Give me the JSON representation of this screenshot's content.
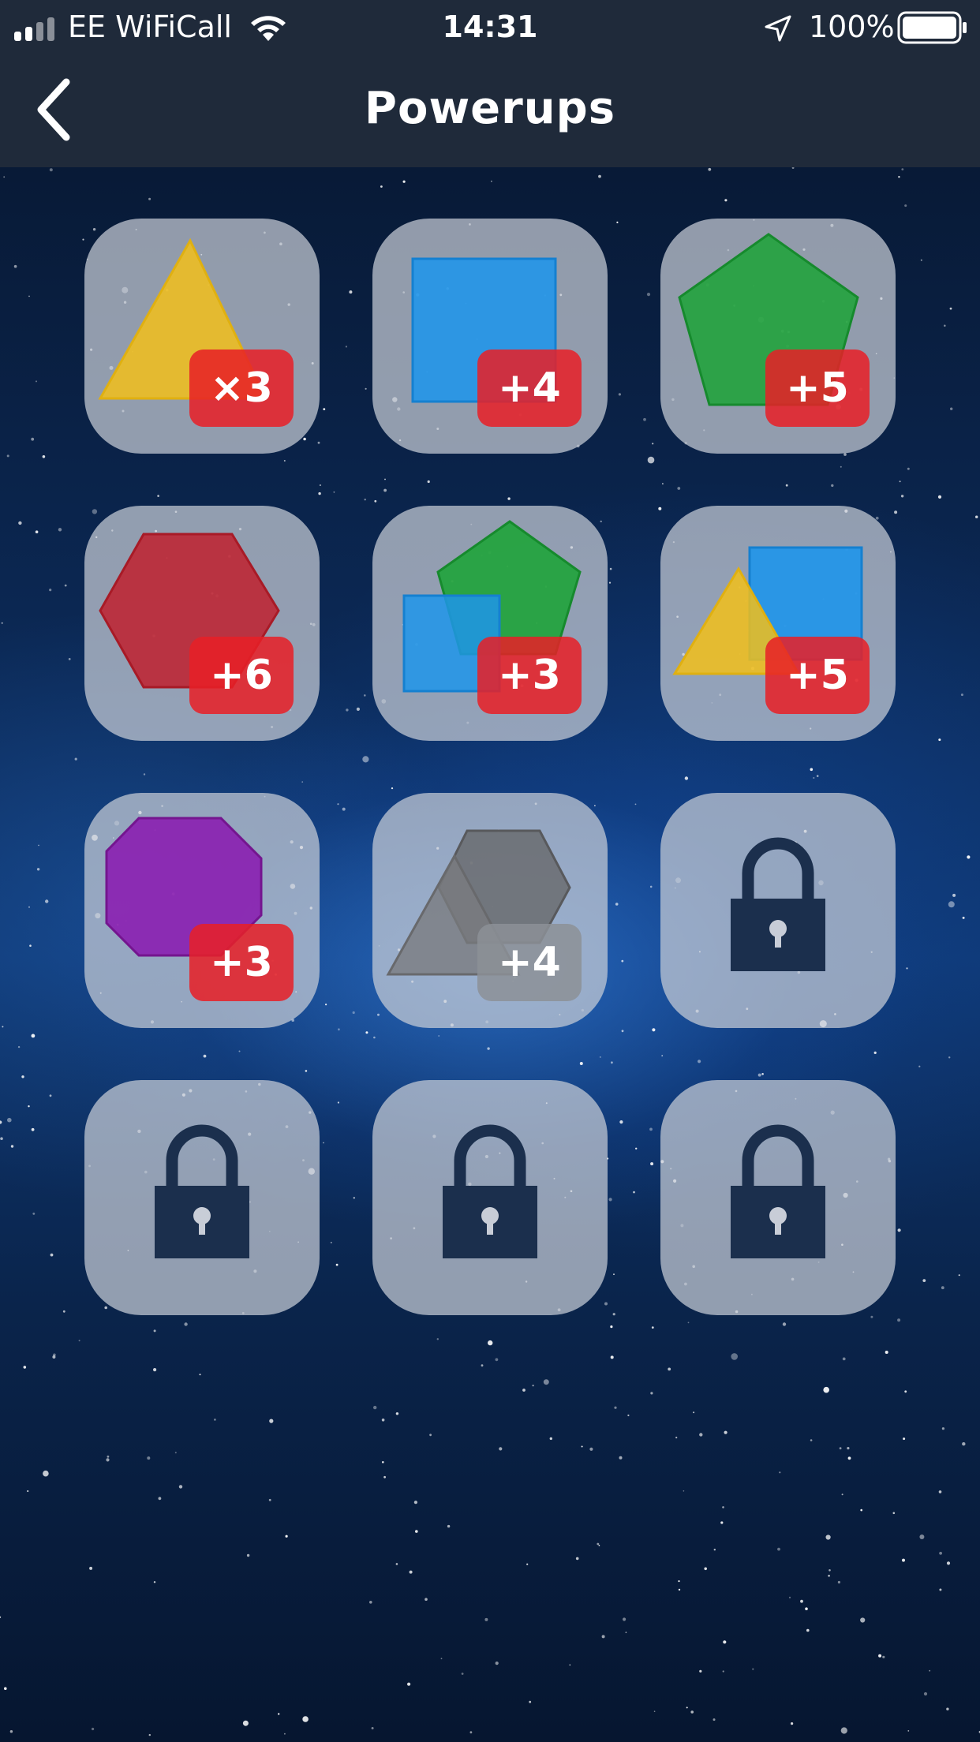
{
  "status_bar": {
    "carrier": "EE WiFiCall",
    "time": "14:31",
    "battery": "100%"
  },
  "nav": {
    "title": "Powerups",
    "back_icon": "chevron-left-icon"
  },
  "powerups": [
    {
      "shapes": "triangle",
      "badge": "×3",
      "locked": false
    },
    {
      "shapes": "square",
      "badge": "+4",
      "locked": false
    },
    {
      "shapes": "pentagon",
      "badge": "+5",
      "locked": false
    },
    {
      "shapes": "hexagon",
      "badge": "+6",
      "locked": false
    },
    {
      "shapes": "square+pentagon",
      "badge": "+3",
      "locked": false
    },
    {
      "shapes": "triangle+square",
      "badge": "+5",
      "locked": false
    },
    {
      "shapes": "octagon",
      "badge": "+3",
      "locked": false
    },
    {
      "shapes": "triangle+hexagon (grey)",
      "badge": "+4",
      "locked": false
    },
    {
      "shapes": "lock-icon",
      "badge": "",
      "locked": true
    },
    {
      "shapes": "lock-icon",
      "badge": "",
      "locked": true
    },
    {
      "shapes": "lock-icon",
      "badge": "",
      "locked": true
    },
    {
      "shapes": "lock-icon",
      "badge": "",
      "locked": true
    }
  ],
  "colors": {
    "bar": "#1f2a3a",
    "tile": "#c8cdd7",
    "badge": "#e82026",
    "badge_disabled": "#8c9096",
    "yellow": "#f2c01a",
    "blue": "#1f95ea",
    "green": "#1fa33a",
    "red": "#c0202e",
    "purple": "#8a1bb0",
    "grey": "#7a7c80",
    "lock": "#1b2f4d"
  }
}
